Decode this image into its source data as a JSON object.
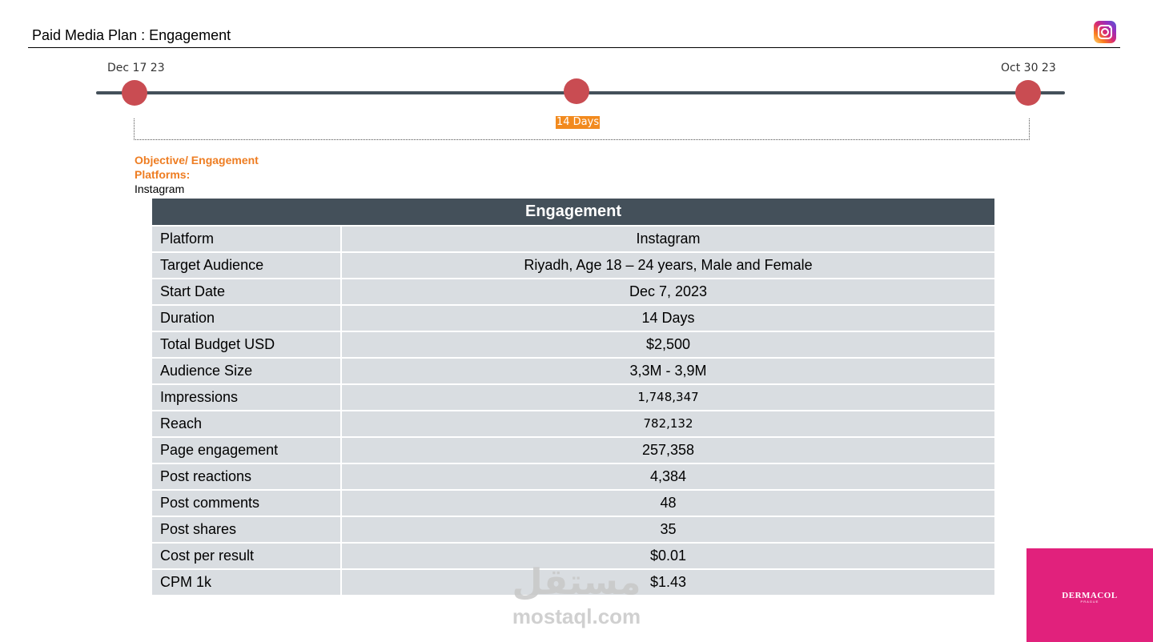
{
  "header": {
    "title": "Paid Media Plan : Engagement",
    "platform_icon": "instagram-icon"
  },
  "timeline": {
    "start_label": "Dec 17 23",
    "end_label": "Oct 30 23",
    "duration_badge": "14 Days",
    "node_color": "#c94c52",
    "badge_color": "#f28a1e"
  },
  "objective": {
    "objective_text": "Objective/ Engagement",
    "platforms_label": "Platforms:",
    "platforms_value": "Instagram",
    "accent_color": "#ee7d22"
  },
  "table": {
    "title": "Engagement",
    "header_color": "#44505a",
    "rows": [
      {
        "label": "Platform",
        "value": "Instagram"
      },
      {
        "label": "Target Audience",
        "value": "Riyadh, Age 18 – 24 years, Male and Female"
      },
      {
        "label": "Start Date",
        "value": "Dec 7, 2023"
      },
      {
        "label": "Duration",
        "value": "14 Days"
      },
      {
        "label": "Total Budget USD",
        "value": "$2,500"
      },
      {
        "label": "Audience Size",
        "value": "3,3M - 3,9M"
      },
      {
        "label": "Impressions",
        "value": "1,748,347"
      },
      {
        "label": "Reach",
        "value": "782,132"
      },
      {
        "label": "Page engagement",
        "value": "257,358"
      },
      {
        "label": "Post reactions",
        "value": "4,384"
      },
      {
        "label": "Post comments",
        "value": "48"
      },
      {
        "label": "Post shares",
        "value": "35"
      },
      {
        "label": "Cost per result",
        "value": "$0.01"
      },
      {
        "label": "CPM 1k",
        "value": "$1.43"
      }
    ]
  },
  "watermark": {
    "arabic": "مستقل",
    "latin": "mostaql.com"
  },
  "brand": {
    "name": "DERMACOL",
    "sub": "PRAGUE",
    "color": "#e1217c"
  }
}
